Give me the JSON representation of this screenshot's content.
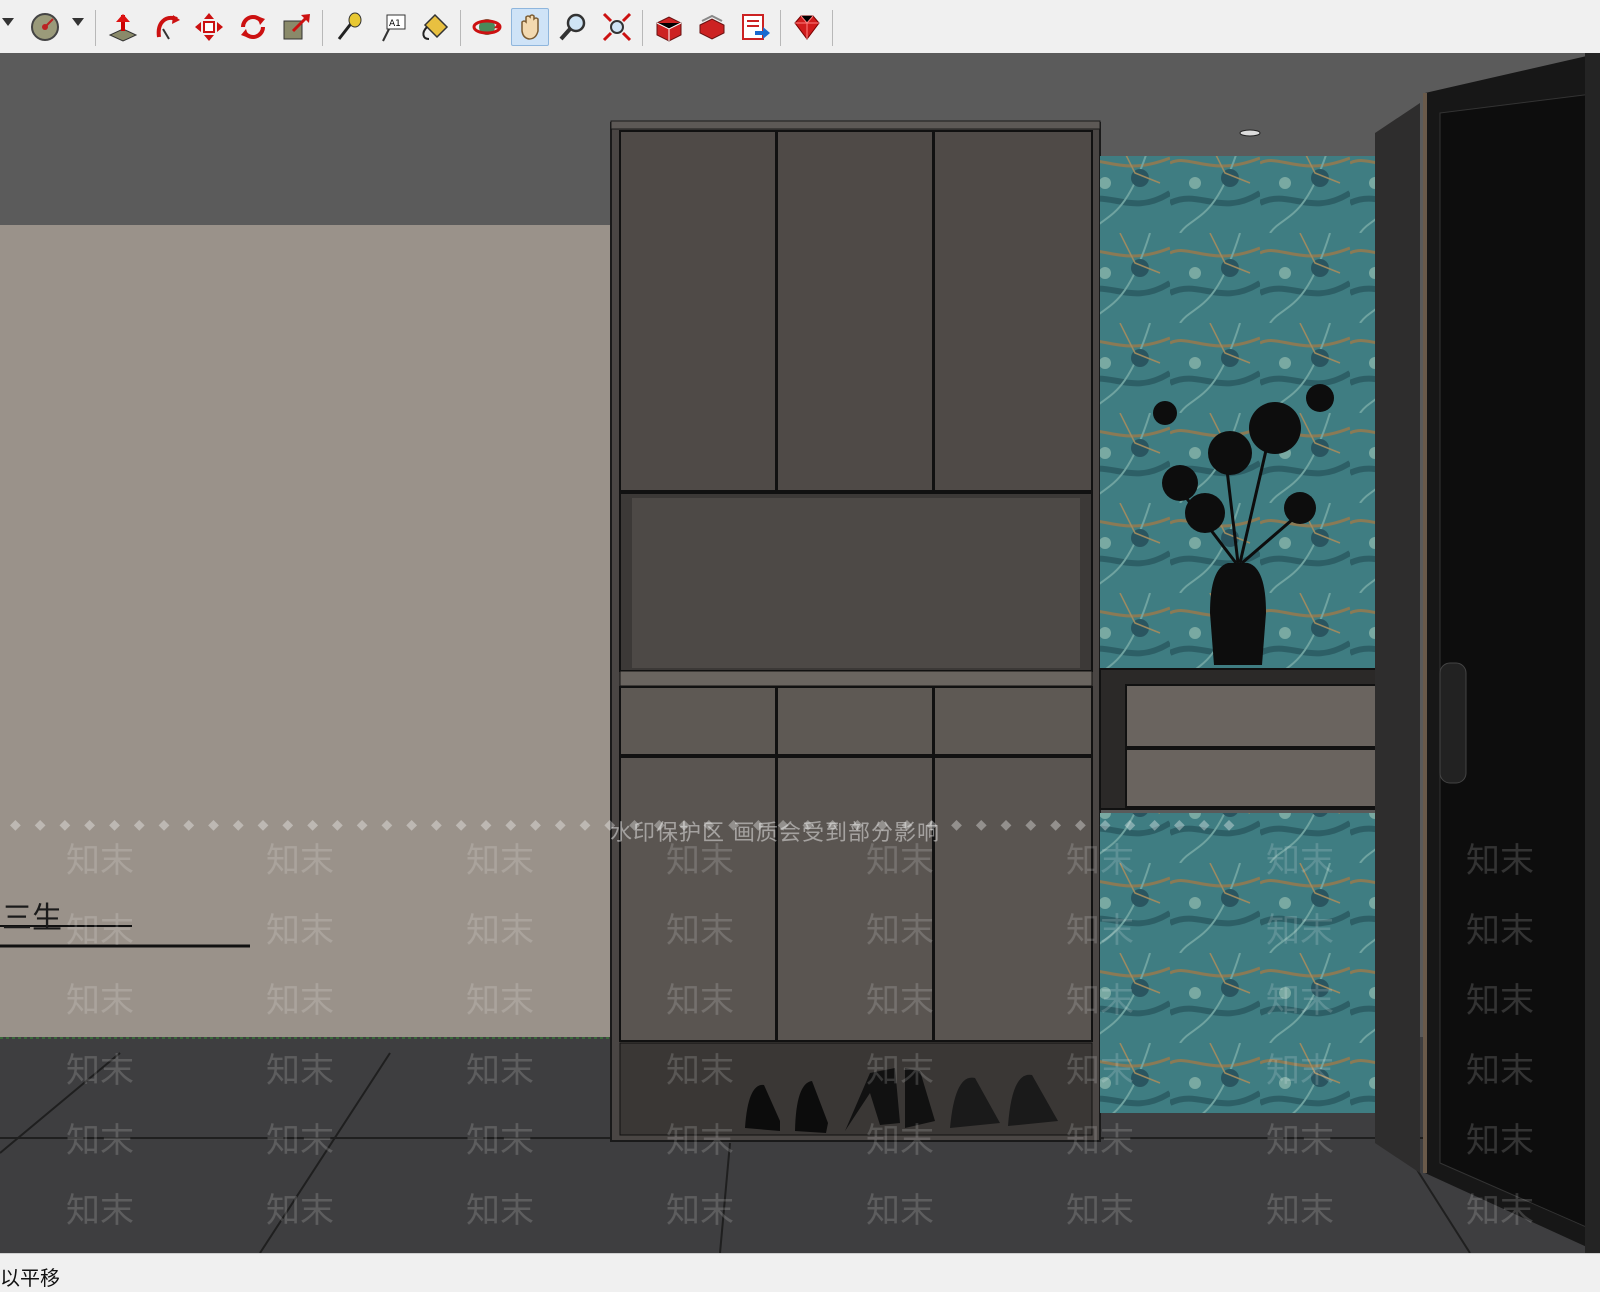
{
  "toolbar": {
    "tools": [
      {
        "name": "dropdown-arrow-icon",
        "tip": ""
      },
      {
        "name": "position-camera-icon",
        "tip": ""
      },
      {
        "name": "push-pull-icon",
        "tip": ""
      },
      {
        "name": "follow-me-icon",
        "tip": ""
      },
      {
        "name": "move-icon",
        "tip": ""
      },
      {
        "name": "rotate-icon",
        "tip": ""
      },
      {
        "name": "scale-icon",
        "tip": ""
      },
      {
        "name": "tape-measure-icon",
        "tip": ""
      },
      {
        "name": "text-icon",
        "tip": "A1"
      },
      {
        "name": "paint-bucket-icon",
        "tip": ""
      },
      {
        "name": "orbit-icon",
        "tip": ""
      },
      {
        "name": "pan-icon",
        "tip": ""
      },
      {
        "name": "zoom-icon",
        "tip": ""
      },
      {
        "name": "zoom-extents-icon",
        "tip": ""
      },
      {
        "name": "warehouse-icon",
        "tip": ""
      },
      {
        "name": "share-model-icon",
        "tip": ""
      },
      {
        "name": "export-icon",
        "tip": ""
      },
      {
        "name": "ruby-icon",
        "tip": ""
      }
    ],
    "active_tool": "pan-icon"
  },
  "viewport": {
    "watermark_banner": "水印保护区  画质会受到部分影响",
    "watermark_text": "知末",
    "wall_sign_text": "三生",
    "diamonds": "◆◆◆◆◆◆◆◆◆◆◆◆◆◆◆◆◆◆◆◆◆◆◆◆◆◆◆◆◆◆◆◆◆◆◆◆◆◆◆◆◆◆◆◆◆◆◆◆◆◆"
  },
  "statusbar": {
    "text": "以平移"
  }
}
